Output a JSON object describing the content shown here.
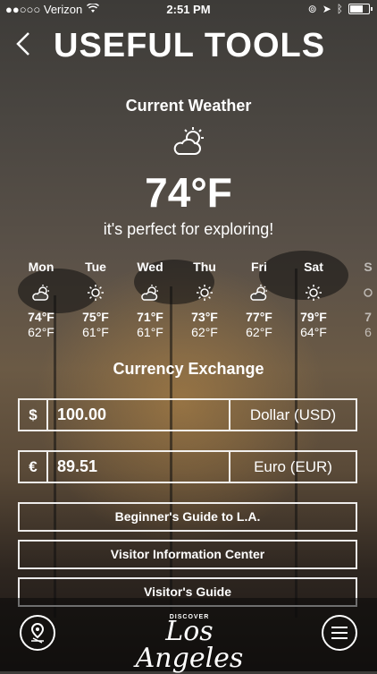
{
  "status_bar": {
    "carrier": "●●○○○ Verizon",
    "time": "2:51 PM"
  },
  "header": {
    "title": "USEFUL TOOLS"
  },
  "current_weather": {
    "title": "Current Weather",
    "icon": "partly-cloudy-icon",
    "temperature": "74°F",
    "tagline": "it's perfect for exploring!"
  },
  "forecast": [
    {
      "day": "Mon",
      "icon": "partly-cloudy-icon",
      "high": "74°F",
      "low": "62°F"
    },
    {
      "day": "Tue",
      "icon": "sunny-icon",
      "high": "75°F",
      "low": "61°F"
    },
    {
      "day": "Wed",
      "icon": "partly-cloudy-icon",
      "high": "71°F",
      "low": "61°F"
    },
    {
      "day": "Thu",
      "icon": "sunny-icon",
      "high": "73°F",
      "low": "62°F"
    },
    {
      "day": "Fri",
      "icon": "partly-cloudy-icon",
      "high": "77°F",
      "low": "62°F"
    },
    {
      "day": "Sat",
      "icon": "sunny-icon",
      "high": "79°F",
      "low": "64°F"
    },
    {
      "day": "S",
      "icon": "sunny-icon",
      "high": "7",
      "low": "6"
    }
  ],
  "currency": {
    "title": "Currency Exchange",
    "rows": [
      {
        "symbol": "$",
        "amount": "100.00",
        "unit": "Dollar (USD)"
      },
      {
        "symbol": "€",
        "amount": "89.51",
        "unit": "Euro (EUR)"
      }
    ]
  },
  "links": [
    {
      "label": "Beginner's Guide to L.A."
    },
    {
      "label": "Visitor Information Center"
    },
    {
      "label": "Visitor's Guide"
    }
  ],
  "brand": {
    "small": "DISCOVER",
    "name": "Los Angeles"
  }
}
